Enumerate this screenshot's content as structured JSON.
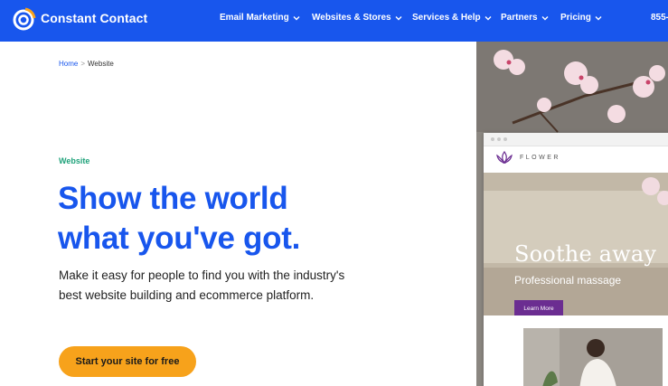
{
  "header": {
    "brand": "Constant Contact",
    "nav": [
      {
        "label": "Email Marketing"
      },
      {
        "label": "Websites & Stores"
      },
      {
        "label": "Services & Help"
      },
      {
        "label": "Partners"
      },
      {
        "label": "Pricing"
      }
    ],
    "phone": "855-"
  },
  "breadcrumb": {
    "home": "Home",
    "separator": ">",
    "current": "Website"
  },
  "hero": {
    "eyebrow": "Website",
    "headline_line1": "Show the world",
    "headline_line2": "what you've got.",
    "subtext": "Make it easy for people to find you with the industry's best website building and ecommerce platform.",
    "cta": "Start your site for free"
  },
  "preview": {
    "site_name": "FLOWER",
    "hero_title": "Soothe away",
    "hero_subtitle": "Professional massage",
    "button": "Learn More"
  },
  "colors": {
    "brand_blue": "#1856ed",
    "eyebrow_green": "#1ea27a",
    "cta_orange": "#f7a21b",
    "preview_purple": "#6b2d91"
  },
  "icons": {
    "logo": "constant-contact-logo-icon",
    "nav_chevron": "chevron-down-icon",
    "flower_logo": "lotus-icon"
  }
}
